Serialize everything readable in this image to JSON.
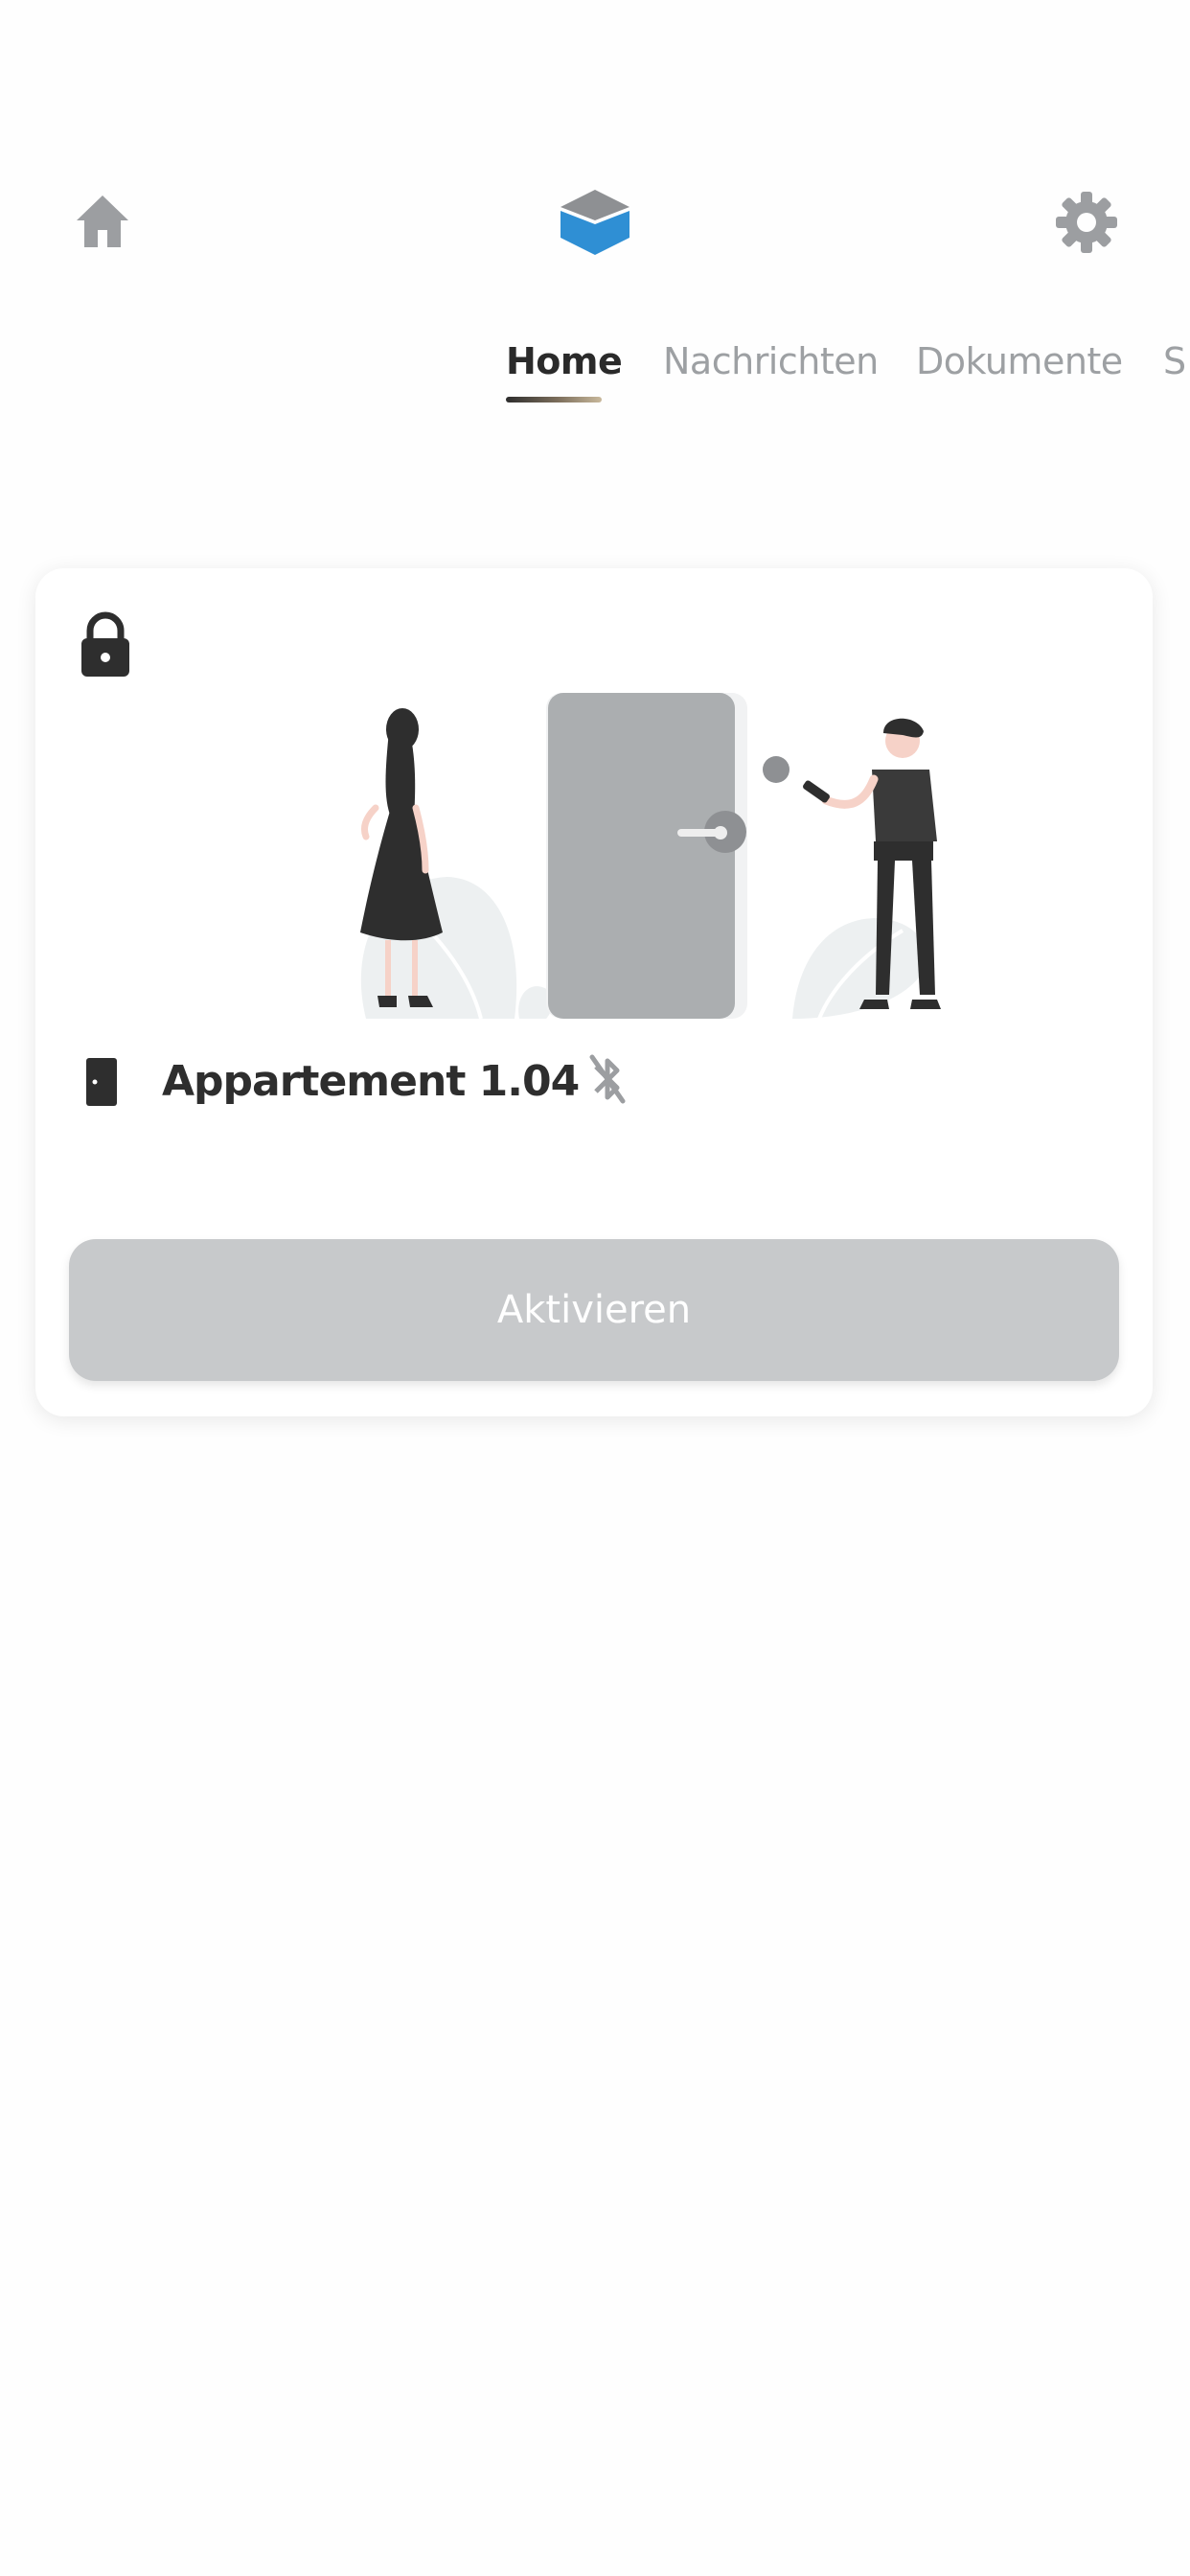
{
  "header": {
    "home_icon": "home-icon",
    "logo_icon": "app-logo",
    "settings_icon": "gear-icon"
  },
  "tabs": [
    {
      "label": "Home",
      "active": true
    },
    {
      "label": "Nachrichten",
      "active": false
    },
    {
      "label": "Dokumente",
      "active": false
    },
    {
      "label": "S",
      "active": false
    }
  ],
  "card": {
    "lock_icon": "lock-icon",
    "device_icon": "door-icon",
    "device_name": "Appartement 1.04",
    "status_icon": "bluetooth-disabled-icon",
    "button_label": "Aktivieren"
  },
  "colors": {
    "accent_blue": "#2f8fd4",
    "icon_gray": "#9c9ea1",
    "dark": "#2e2e2e",
    "button_disabled": "#c7c9cb"
  }
}
